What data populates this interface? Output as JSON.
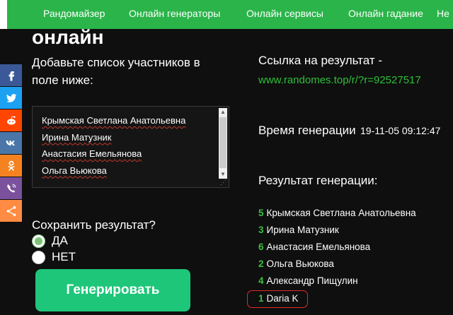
{
  "nav": {
    "items": [
      "Рандомайзер",
      "Онлайн генераторы",
      "Онлайн сервисы",
      "Онлайн гадание",
      "Не"
    ]
  },
  "page": {
    "title": "онлайн",
    "add_list_label": "Добавьте список участников в поле ниже:"
  },
  "participants": {
    "lines": [
      "Крымская Светлана Анатольевна",
      "Ирина Матузник",
      "Анастасия Емельянова",
      "Ольга Вьюкова"
    ]
  },
  "save": {
    "label": "Сохранить результат?",
    "options": [
      {
        "label": "ДА",
        "checked": true
      },
      {
        "label": "НЕТ",
        "checked": false
      }
    ]
  },
  "generate_button": "Генерировать",
  "social": [
    {
      "icon": "facebook-icon",
      "color": "#3b5998"
    },
    {
      "icon": "twitter-icon",
      "color": "#1da1f2"
    },
    {
      "icon": "reddit-icon",
      "color": "#ff4500"
    },
    {
      "icon": "vk-icon",
      "color": "#4a76a8"
    },
    {
      "icon": "odnoklassniki-icon",
      "color": "#f58220"
    },
    {
      "icon": "viber-icon",
      "color": "#7b519d"
    },
    {
      "icon": "share-icon",
      "color": "#ff8c42"
    }
  ],
  "result": {
    "link_label": "Ссылка на результат -",
    "link_url": "www.randomes.top/r/?r=92527517",
    "time_label": "Время генерации",
    "time_value": "19-11-05 09:12:47",
    "result_label": "Результат генерации:",
    "items": [
      {
        "num": "5",
        "name": "Крымская Светлана Анатольевна"
      },
      {
        "num": "3",
        "name": "Ирина Матузник"
      },
      {
        "num": "6",
        "name": "Анастасия Емельянова"
      },
      {
        "num": "2",
        "name": "Ольга Вьюкова"
      },
      {
        "num": "4",
        "name": "Александр Пищулин"
      },
      {
        "num": "1",
        "name": "Daria K"
      }
    ]
  },
  "colors": {
    "nav_green": "#2bb44a",
    "button_green": "#1ec67a",
    "link_green": "#2fbf3a",
    "highlight_red": "#e02a2a"
  }
}
